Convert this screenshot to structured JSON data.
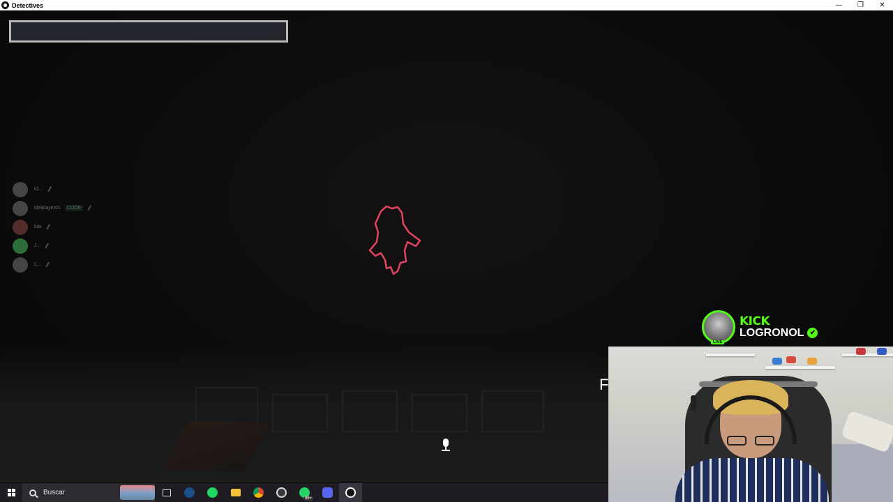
{
  "window": {
    "title": "Detectives",
    "minimize": "—",
    "restore": "❐",
    "close": "✕"
  },
  "game": {
    "search_value": "",
    "overlay_letter": "F",
    "players": [
      {
        "name": "iG...",
        "avatar": "gray"
      },
      {
        "name": "idelplayer01",
        "tag": "CODE",
        "avatar": "gray"
      },
      {
        "name": "luis",
        "avatar": "red"
      },
      {
        "name": "J...",
        "avatar": "green"
      },
      {
        "name": "L...",
        "avatar": "gray"
      }
    ]
  },
  "stream_badge": {
    "platform": "KICK",
    "username": "LOGRONOL",
    "live_label": "LIVE",
    "verified_icon": "✔",
    "accent_color": "#53fc18"
  },
  "taskbar": {
    "search_placeholder": "Buscar",
    "whatsapp_badge": "99+",
    "icons": [
      "windows-start-icon",
      "search-icon",
      "task-view-icon",
      "steam-icon",
      "spotify-icon",
      "file-explorer-icon",
      "chrome-icon",
      "obs-icon",
      "whatsapp-icon",
      "discord-icon",
      "game-app-icon"
    ]
  }
}
